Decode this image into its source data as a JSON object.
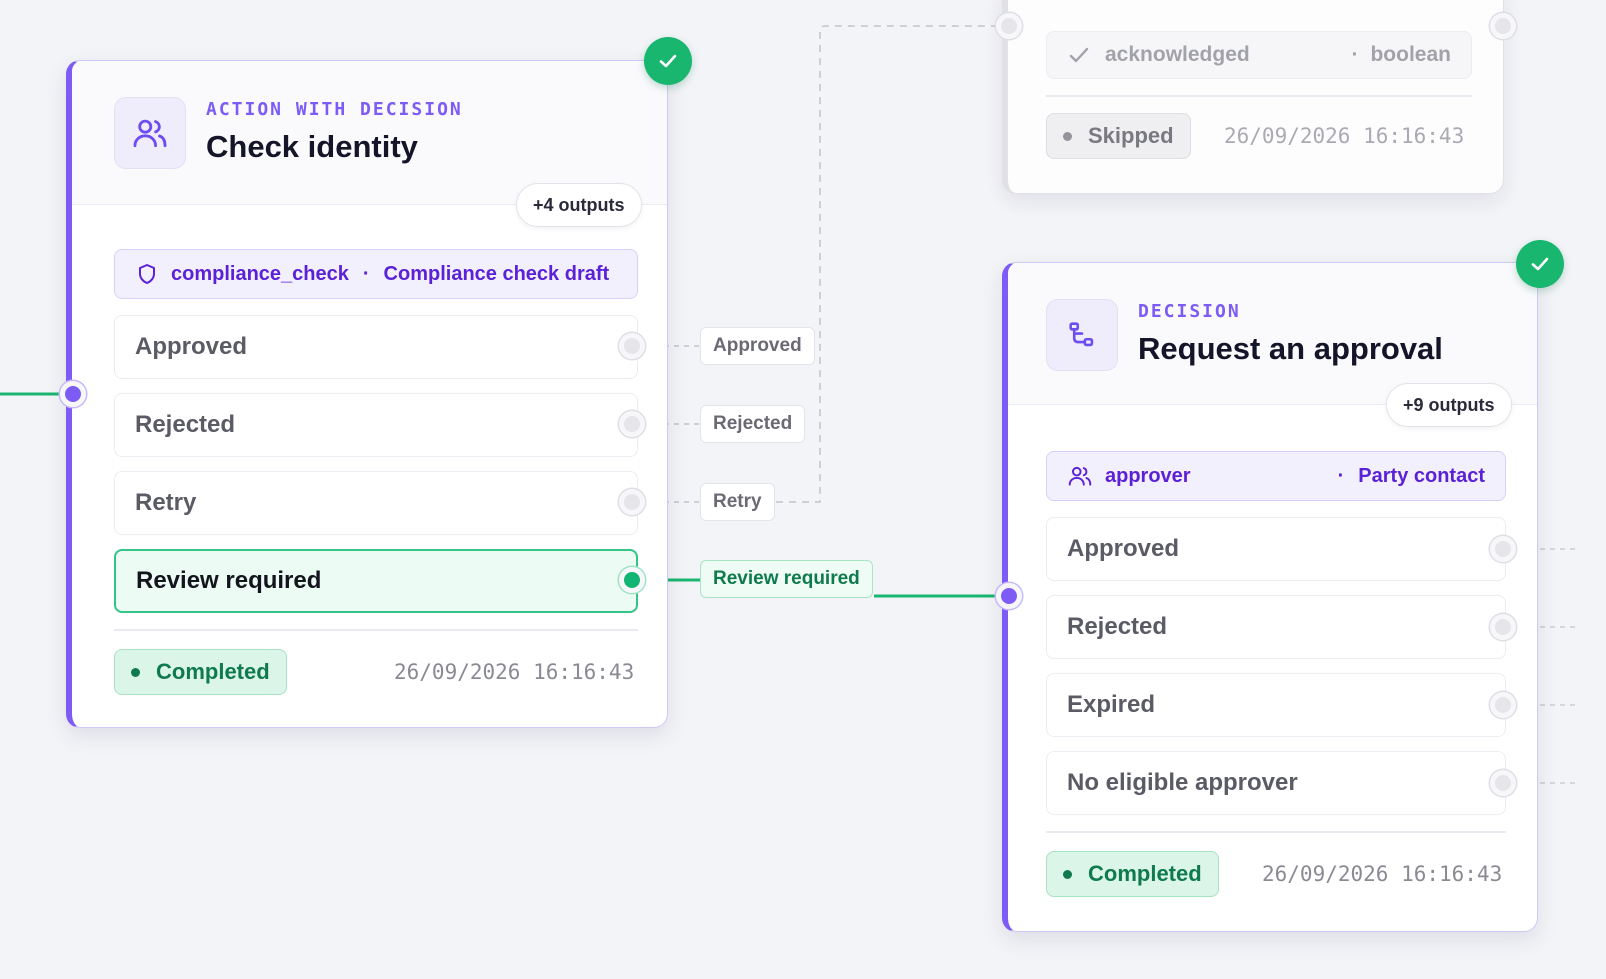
{
  "colors": {
    "accent": "#7c5cf5",
    "success": "#19b670",
    "muted": "#8a8a93"
  },
  "node_skipped": {
    "field_name": "acknowledged",
    "field_type": "boolean",
    "field_icon": "check-icon",
    "status": "Skipped",
    "timestamp": "26/09/2026 16:16:43"
  },
  "node_check_identity": {
    "eyebrow": "ACTION WITH DECISION",
    "title": "Check identity",
    "icon": "users-icon",
    "outputs_label": "+4 outputs",
    "tag_key": "compliance_check",
    "tag_value": "Compliance check draft",
    "tag_icon": "shield-icon",
    "outcomes": [
      "Approved",
      "Rejected",
      "Retry",
      "Review required"
    ],
    "status": "Completed",
    "timestamp": "26/09/2026 16:16:43"
  },
  "edge_labels": [
    "Approved",
    "Rejected",
    "Retry",
    "Review required"
  ],
  "node_request_approval": {
    "eyebrow": "DECISION",
    "title": "Request an approval",
    "icon": "branch-icon",
    "outputs_label": "+9 outputs",
    "tag_key": "approver",
    "tag_value": "Party contact",
    "tag_icon": "users-icon",
    "outcomes": [
      "Approved",
      "Rejected",
      "Expired",
      "No eligible approver"
    ],
    "status": "Completed",
    "timestamp": "26/09/2026 16:16:43"
  }
}
